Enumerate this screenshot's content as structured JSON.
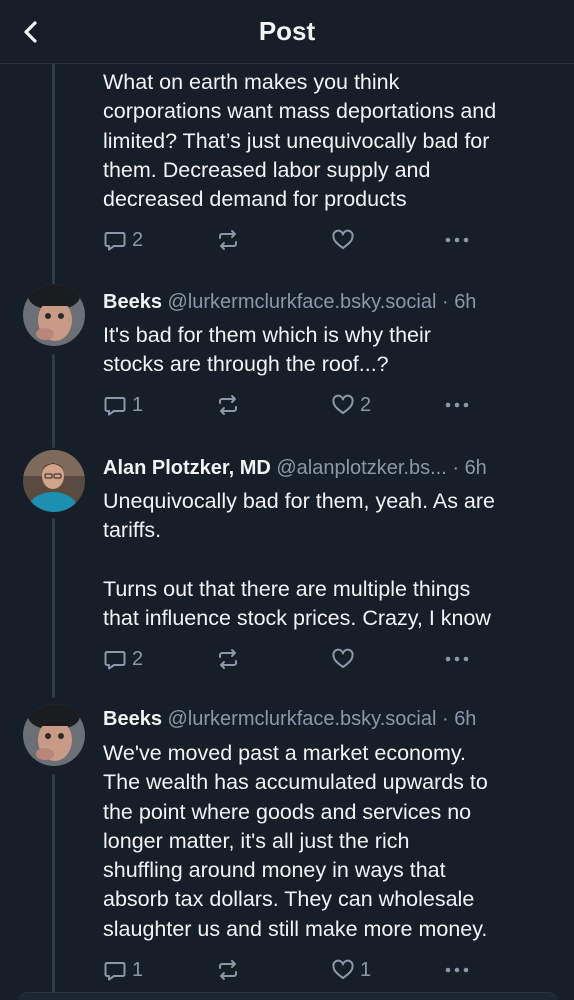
{
  "header": {
    "title": "Post"
  },
  "posts": [
    {
      "text": "What on earth makes you think\ncorporations want mass deportations and\nlimited? That’s just unequivocally bad for\nthem. Decreased labor supply and\ndecreased demand for products",
      "replies": "2",
      "likes": ""
    },
    {
      "name": "Beeks",
      "handle": "@lurkermclurkface.bsky.social",
      "time": "6h",
      "text": "It's bad for them which is why their\nstocks are through the roof...?",
      "replies": "1",
      "likes": "2"
    },
    {
      "name": "Alan Plotzker, MD",
      "handle": "@alanplotzker.bs...",
      "time": "6h",
      "text": "Unequivocally bad for them, yeah. As are\ntariffs.\n\nTurns out that there are multiple things\nthat influence stock prices. Crazy, I know",
      "replies": "2",
      "likes": ""
    },
    {
      "name": "Beeks",
      "handle": "@lurkermclurkface.bsky.social",
      "time": "6h",
      "text": "We've moved past a market economy.\nThe wealth has accumulated upwards to\nthe point where goods and services no\nlonger matter, it's all just the rich\nshuffling around money in ways that\nabsorb tax dollars. They can wholesale\nslaughter us and still make more money.",
      "replies": "1",
      "likes": "1"
    }
  ],
  "separator": "·",
  "colors": {
    "background": "#161e27",
    "text": "#f1f3f5",
    "muted": "#8b98a9",
    "thread_line": "#2f3a47"
  }
}
